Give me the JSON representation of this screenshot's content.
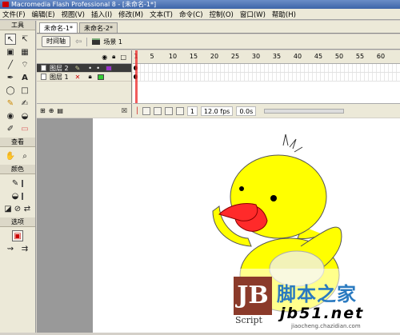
{
  "title": "Macromedia Flash Professional 8 - [未命名-1*]",
  "menu": [
    "文件(F)",
    "编辑(E)",
    "视图(V)",
    "插入(I)",
    "修改(M)",
    "文本(T)",
    "命令(C)",
    "控制(O)",
    "窗口(W)",
    "帮助(H)"
  ],
  "toolbox": {
    "tools_label": "工具",
    "view_label": "查看",
    "colors_label": "颜色",
    "options_label": "选项"
  },
  "tabs": [
    "未命名-1*",
    "未命名-2*"
  ],
  "editbar": {
    "timeline_button": "时间轴",
    "scene": "场景 1"
  },
  "layers": [
    {
      "name": "图层 2",
      "selected": true,
      "color": "#9933cc"
    },
    {
      "name": "图层 1",
      "selected": false,
      "color": "#33cc33"
    }
  ],
  "ruler": [
    "1",
    "5",
    "10",
    "15",
    "20",
    "25",
    "30",
    "35",
    "40",
    "45",
    "50",
    "55",
    "60"
  ],
  "status": {
    "frame": "1",
    "fps": "12.0 fps",
    "time": "0.0s"
  },
  "watermark": {
    "logo": "JB",
    "script": "Script",
    "chinese": "脚本之家",
    "site": "jb51.net",
    "url": "jiaocheng.chazidian.com"
  },
  "colors": {
    "duck_body": "#ffff00",
    "duck_beak": "#ff2a2a",
    "wing": "#f2f2b8"
  }
}
